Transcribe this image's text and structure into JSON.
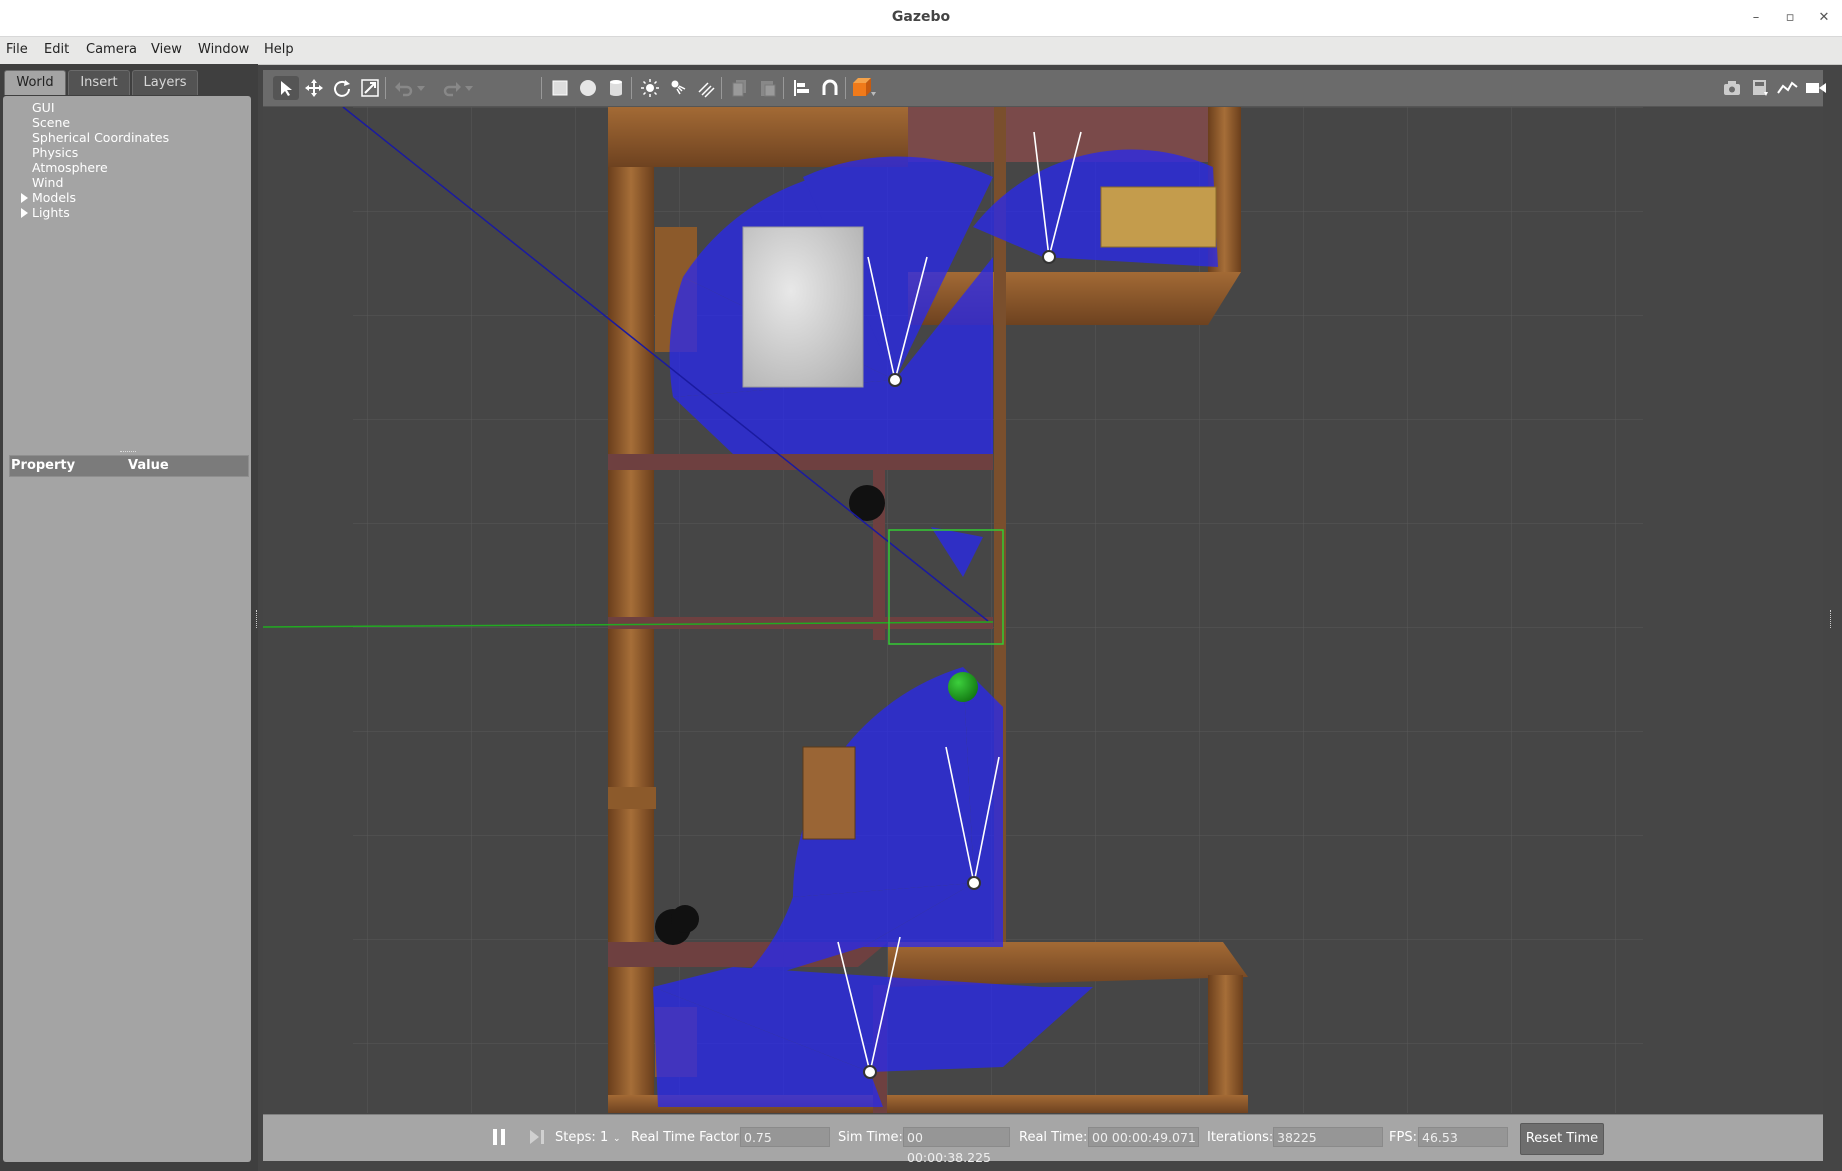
{
  "window": {
    "title": "Gazebo",
    "controls": {
      "minimize": "–",
      "maximize": "▫",
      "close": "✕"
    }
  },
  "menu": [
    "File",
    "Edit",
    "Camera",
    "View",
    "Window",
    "Help"
  ],
  "left_panel": {
    "tabs": [
      "World",
      "Insert",
      "Layers"
    ],
    "active_tab": "World",
    "tree": [
      "GUI",
      "Scene",
      "Spherical Coordinates",
      "Physics",
      "Atmosphere",
      "Wind",
      "Models",
      "Lights"
    ],
    "property_header": {
      "property": "Property",
      "value": "Value"
    }
  },
  "toolbar": {
    "tools": [
      "select-tool",
      "translate-tool",
      "rotate-tool",
      "scale-tool",
      "undo",
      "undo-history",
      "redo",
      "redo-history",
      "box-shape",
      "sphere-shape",
      "cylinder-shape",
      "point-light",
      "spot-light",
      "directional-light",
      "copy",
      "paste",
      "align",
      "snap",
      "change-view"
    ],
    "right_tools": [
      "screenshot",
      "log",
      "plot",
      "video-record"
    ]
  },
  "bottom_bar": {
    "steps_label": "Steps:",
    "steps_value": "1",
    "rtf_label": "Real Time Factor:",
    "rtf_value": "0.75",
    "sim_time_label": "Sim Time:",
    "sim_time_value": "00 00:00:38.225",
    "real_time_label": "Real Time:",
    "real_time_value": "00 00:00:49.071",
    "iterations_label": "Iterations:",
    "iterations_value": "38225",
    "fps_label": "FPS:",
    "fps_value": "46.53",
    "reset_label": "Reset Time"
  },
  "colors": {
    "panel_bg": "#a4a4a4",
    "viewport_bg": "#464646",
    "wood": "#8a5a2b",
    "wall_brick": "#6e4040",
    "laser": "#2222ee",
    "selection": "#33cc33"
  }
}
